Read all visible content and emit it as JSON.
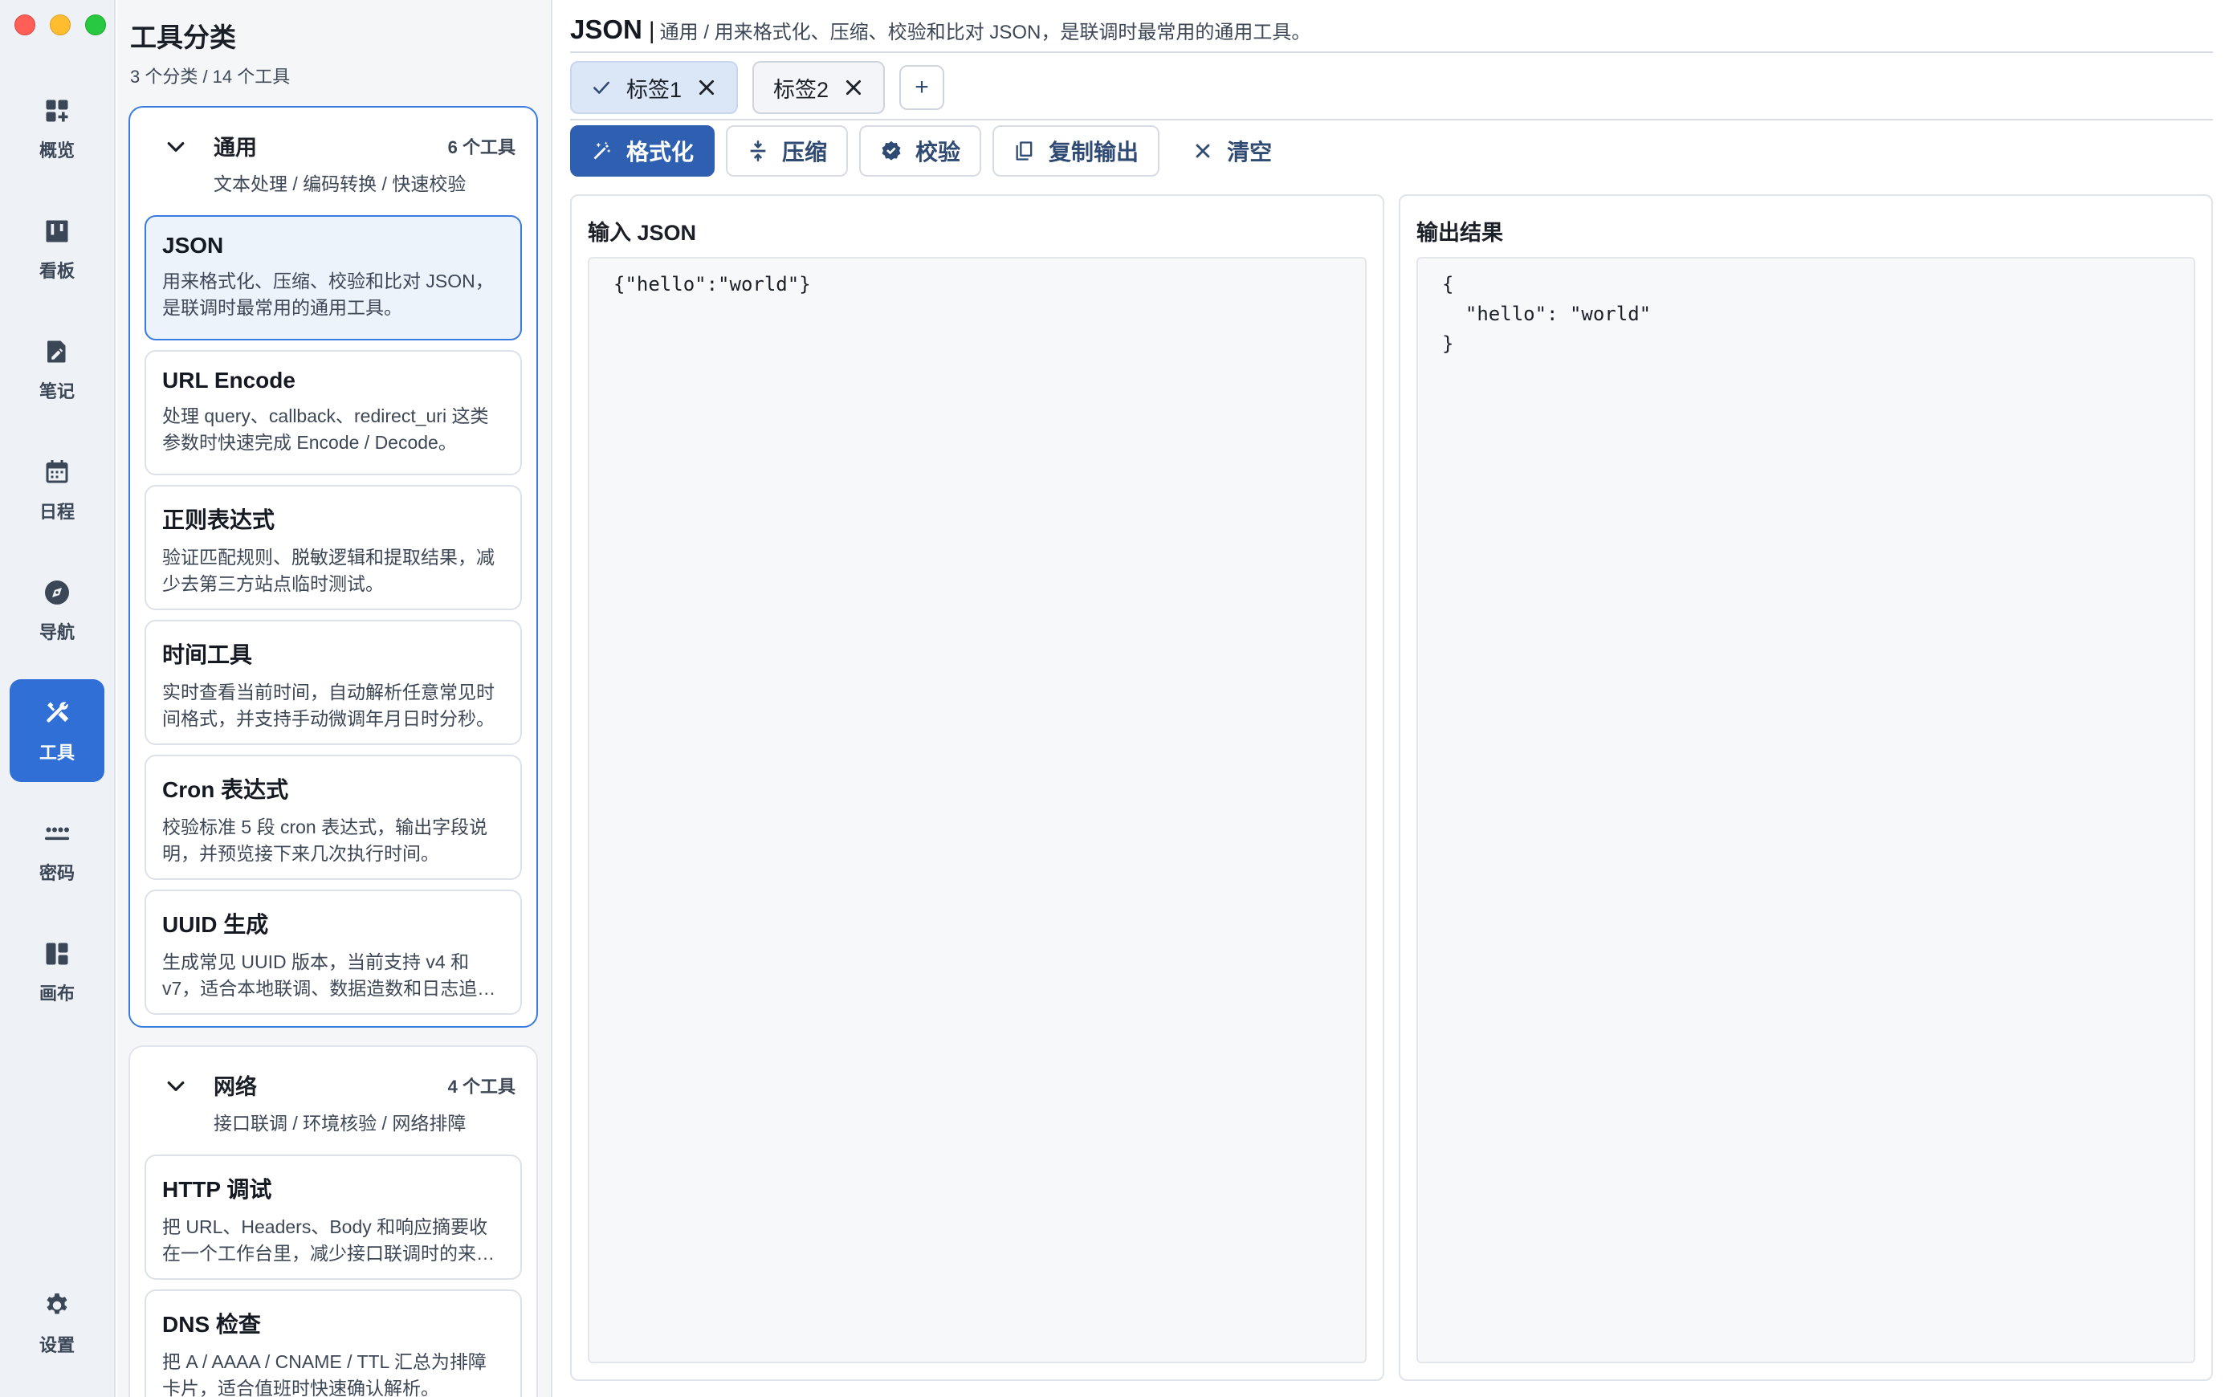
{
  "rail": {
    "items": [
      {
        "label": "概览",
        "icon": "dashboard-add-icon"
      },
      {
        "label": "看板",
        "icon": "kanban-icon"
      },
      {
        "label": "笔记",
        "icon": "note-edit-icon"
      },
      {
        "label": "日程",
        "icon": "calendar-icon"
      },
      {
        "label": "导航",
        "icon": "compass-icon"
      },
      {
        "label": "工具",
        "icon": "tools-icon",
        "active": true
      },
      {
        "label": "密码",
        "icon": "password-icon"
      },
      {
        "label": "画布",
        "icon": "canvas-layout-icon"
      }
    ],
    "settings": {
      "label": "设置",
      "icon": "gear-icon"
    }
  },
  "categories": {
    "title": "工具分类",
    "summary": "3 个分类 / 14 个工具",
    "groups": [
      {
        "name": "通用",
        "count": "6 个工具",
        "desc": "文本处理 / 编码转换 / 快速校验",
        "expanded": true,
        "tools": [
          {
            "name": "JSON",
            "desc": "用来格式化、压缩、校验和比对 JSON，是联调时最常用的通用工具。"
          },
          {
            "name": "URL Encode",
            "desc": "处理 query、callback、redirect_uri 这类参数时快速完成 Encode / Decode。"
          },
          {
            "name": "正则表达式",
            "desc": "验证匹配规则、脱敏逻辑和提取结果，减少去第三方站点临时测试。"
          },
          {
            "name": "时间工具",
            "desc": "实时查看当前时间，自动解析任意常见时间格式，并支持手动微调年月日时分秒。"
          },
          {
            "name": "Cron 表达式",
            "desc": "校验标准 5 段 cron 表达式，输出字段说明，并预览接下来几次执行时间。"
          },
          {
            "name": "UUID 生成",
            "desc": "生成常见 UUID 版本，当前支持 v4 和 v7，适合本地联调、数据造数和日志追踪。"
          }
        ]
      },
      {
        "name": "网络",
        "count": "4 个工具",
        "desc": "接口联调 / 环境核验 / 网络排障",
        "expanded": true,
        "tools": [
          {
            "name": "HTTP 调试",
            "desc": "把 URL、Headers、Body 和响应摘要收在一个工作台里，减少接口联调时的来回切换。"
          },
          {
            "name": "DNS 检查",
            "desc": "把 A / AAAA / CNAME / TTL 汇总为排障卡片，适合值班时快速确认解析。"
          }
        ]
      }
    ]
  },
  "header": {
    "title": "JSON",
    "separator": "|",
    "desc": "通用 / 用来格式化、压缩、校验和比对 JSON，是联调时最常用的通用工具。"
  },
  "tabs": [
    {
      "label": "标签1",
      "active": true
    },
    {
      "label": "标签2",
      "active": false
    }
  ],
  "tab_add_label": "+",
  "toolbar": {
    "format": "格式化",
    "compress": "压缩",
    "validate": "校验",
    "copy": "复制输出",
    "clear": "清空"
  },
  "input_pane": {
    "title": "输入 JSON",
    "value": "{\"hello\":\"world\"}"
  },
  "output_pane": {
    "title": "输出结果",
    "value": "{\n  \"hello\": \"world\"\n}"
  },
  "colors": {
    "accent": "#2f6fd6",
    "primary_button": "#2f5fb0",
    "selected_border": "#3a7be0"
  }
}
